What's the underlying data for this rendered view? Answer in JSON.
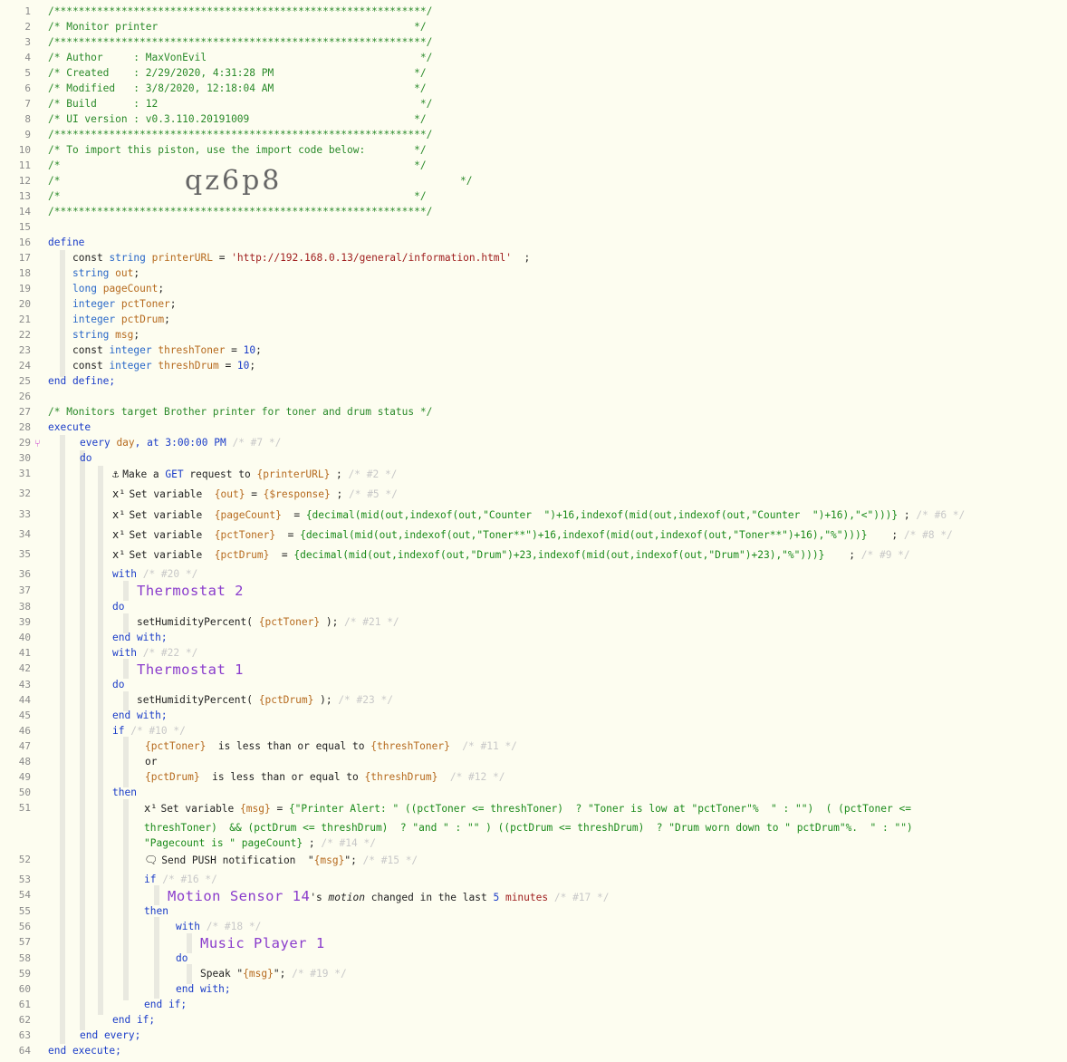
{
  "header_comment": {
    "stars": "/*************************************************************/",
    "title": "/* Monitor printer                                          */",
    "author": "/* Author     : MaxVonEvil                                   */",
    "created": "/* Created    : 2/29/2020, 4:31:28 PM                       */",
    "modified": "/* Modified   : 3/8/2020, 12:18:04 AM                       */",
    "build": "/* Build      : 12                                           */",
    "ui_version": "/* UI version : v0.3.110.20191009                           */",
    "import_note": "/* To import this piston, use the import code below:        */",
    "blank_a": "/*                                                          */",
    "blank_b": "/*",
    "blank_b_end": "*/",
    "import_code": "qz6p8"
  },
  "define": {
    "kw_define": "define",
    "kw_const": "const",
    "t_string": "string",
    "t_long": "long",
    "t_integer": "integer",
    "printerURL": "printerURL",
    "printerURL_value": "'http://192.168.0.13/general/information.html'",
    "out": "out",
    "pageCount": "pageCount",
    "pctToner": "pctToner",
    "pctDrum": "pctDrum",
    "msg": "msg",
    "threshToner": "threshToner",
    "threshDrum": "threshDrum",
    "thresh_value": "10",
    "end_define": "end define;"
  },
  "execute": {
    "comment": "/* Monitors target Brother printer for toner and drum status */",
    "kw_execute": "execute",
    "every": "every",
    "day": "day",
    "at": ", at",
    "time": "3:00:00 PM",
    "c7": "/* #7 */",
    "kw_do": "do",
    "get_label": "Make a",
    "get_kw": "GET",
    "get_rest": "request to",
    "get_var": "{printerURL}",
    "c2": "/* #2 */",
    "set_variable": "Set variable",
    "set_out_var": "{out}",
    "set_out_expr": "{$response}",
    "c5": "/* #5 */",
    "set_pc_var": "{pageCount}",
    "set_pc_expr": "{decimal(mid(out,indexof(out,\"Counter  \")+16,indexof(mid(out,indexof(out,\"Counter  \")+16),\"<\")))}",
    "c6": "/* #6 */",
    "set_pt_var": "{pctToner}",
    "set_pt_expr": "{decimal(mid(out,indexof(out,\"Toner**\")+16,indexof(mid(out,indexof(out,\"Toner**\")+16),\"%\")))}",
    "c8": "/* #8 */",
    "set_pd_var": "{pctDrum}",
    "set_pd_expr": "{decimal(mid(out,indexof(out,\"Drum\")+23,indexof(mid(out,indexof(out,\"Drum\")+23),\"%\")))}",
    "c9": "/* #9 */",
    "kw_with": "with",
    "c20": "/* #20 */",
    "device_t2": "Thermostat 2",
    "hum_cmd": "setHumidityPercent(",
    "hum_toner": "{pctToner}",
    "c21": "/* #21 */",
    "end_with": "end with;",
    "c22": "/* #22 */",
    "device_t1": "Thermostat 1",
    "hum_drum": "{pctDrum}",
    "c23": "/* #23 */",
    "kw_if": "if",
    "c10": "/* #10 */",
    "cond1_var": "{pctToner}",
    "cond_op": "is less than or equal to",
    "cond1_val": "{threshToner}",
    "c11": "/* #11 */",
    "kw_or": "or",
    "cond2_var": "{pctDrum}",
    "cond2_val": "{threshDrum}",
    "c12": "/* #12 */",
    "kw_then": "then",
    "set_msg_var": "{msg}",
    "msg_expr_1": "{\"Printer Alert: \" ((pctToner <= threshToner)  ? \"Toner is low at \"pctToner\"%  \" : \"\")  ( (pctToner <=",
    "msg_expr_2": "threshToner)  && (pctDrum <= threshDrum)  ? \"and \" : \"\" ) ((pctDrum <= threshDrum)  ? \"Drum worn down to \" pctDrum\"%.  \" : \"\")",
    "msg_expr_3": "\"Pagecount is \" pageCount}",
    "c14": "/* #14 */",
    "push_label": "Send PUSH notification",
    "push_msg": "{msg}",
    "c15": "/* #15 */",
    "c16": "/* #16 */",
    "device_motion": "Motion Sensor 14",
    "motion_tail_1": "'s",
    "motion_attr": "motion",
    "motion_tail_2": "changed in the last",
    "motion_num": "5",
    "motion_unit": "minutes",
    "c17": "/* #17 */",
    "c18": "/* #18 */",
    "device_player": "Music Player 1",
    "speak_label": "Speak",
    "speak_msg": "{msg}",
    "c19": "/* #19 */",
    "end_if": "end if;",
    "end_every": "end every;",
    "end_execute": "end execute;"
  },
  "line_numbers": [
    "1",
    "2",
    "3",
    "4",
    "5",
    "6",
    "7",
    "8",
    "9",
    "10",
    "11",
    "12",
    "13",
    "14",
    "15",
    "16",
    "17",
    "18",
    "19",
    "20",
    "21",
    "22",
    "23",
    "24",
    "25",
    "26",
    "27",
    "28",
    "29",
    "30",
    "31",
    "32",
    "33",
    "34",
    "35",
    "36",
    "37",
    "38",
    "39",
    "40",
    "41",
    "42",
    "43",
    "44",
    "45",
    "46",
    "47",
    "48",
    "49",
    "50",
    "51",
    "52",
    "53",
    "54",
    "55",
    "56",
    "57",
    "58",
    "59",
    "60",
    "61",
    "62",
    "63",
    "64"
  ],
  "icons": {
    "anchor": "anchor-icon",
    "variable": "variable-icon",
    "push": "push-notification-icon",
    "pivot": "pivot-icon"
  },
  "colors": {
    "background": "#fdfdf0",
    "comment": "#2a8a2a",
    "keyword": "#1a3cc8",
    "type": "#2a68c8",
    "variable": "#b66a1e",
    "device": "#8a3ccc",
    "faded_comment": "#c8c8c8"
  }
}
